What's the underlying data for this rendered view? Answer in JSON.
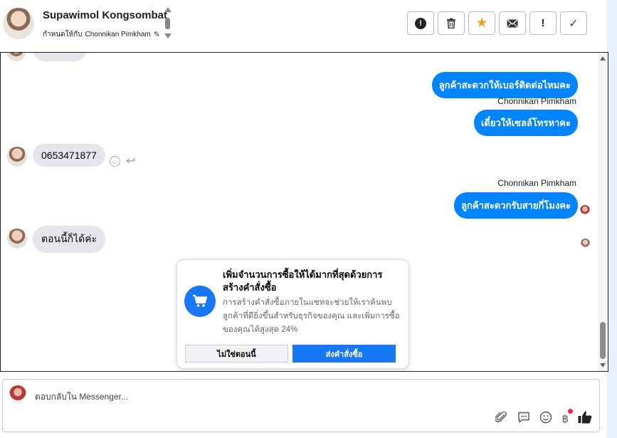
{
  "header": {
    "contact_name": "Supawimol Kongsombat",
    "assigned_prefix": "กำหนดให้กับ",
    "assigned_to": "Chonnikan Pimkham"
  },
  "toolbar": {
    "buttons": [
      {
        "name": "spam-button",
        "icon": "exclamation-circle-icon"
      },
      {
        "name": "delete-button",
        "icon": "trash-icon"
      },
      {
        "name": "star-button",
        "icon": "star-icon"
      },
      {
        "name": "mark-unread-button",
        "icon": "envelope-icon"
      },
      {
        "name": "follow-up-button",
        "icon": "exclamation-icon"
      },
      {
        "name": "mark-done-button",
        "icon": "check-icon"
      }
    ]
  },
  "messages": {
    "out1": "ลูกค้าสะดวกให้เบอร์ติดต่อไหมคะ",
    "sender1": "Chonnikan Pimkham",
    "out2": "เดี๋ยวให้เซลล์โทรหาคะ",
    "in1": "0653471877",
    "sender2": "Chonnikan Pimkham",
    "out3": "ลูกค้าสะดวกรับสายกี่โมงคะ",
    "in2": "ตอนนี้ก็ได้ค่ะ"
  },
  "promo": {
    "title": "เพิ่มจำนวนการซื้อให้ได้มากที่สุดด้วยการสร้างคำสั่งซื้อ",
    "body": "การสร้างคำสั่งซื้อภายในแชทจะช่วยให้เราค้นพบลูกค้าที่ดียิ่งขึ้นสำหรับธุรกิจของคุณ และเพิ่มการซื้อของคุณได้สูงสุด 24%",
    "secondary_label": "ไม่ใช่ตอนนี้",
    "primary_label": "ส่งคำสั่งซื้อ",
    "icon": "cart-icon"
  },
  "composer": {
    "placeholder": "ตอบกลับใน Messenger...",
    "tools": [
      "paperclip-icon",
      "comment-icon",
      "emoji-icon",
      "baht-icon",
      "thumbs-up-icon"
    ],
    "notification_color": "#f02849"
  },
  "colors": {
    "accent": "#0084ff",
    "brand": "#1877f2",
    "star": "#f39c27"
  }
}
